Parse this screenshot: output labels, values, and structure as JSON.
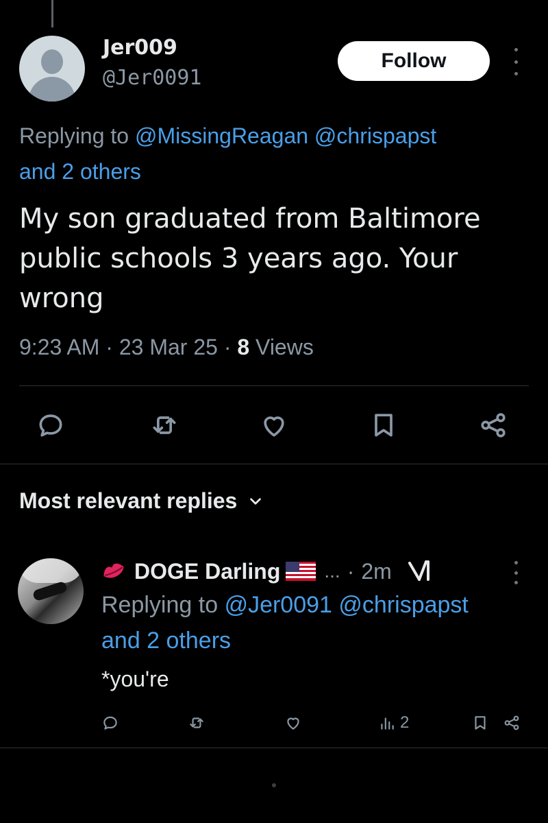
{
  "colors": {
    "background": "#000000",
    "link": "#4a9fe8",
    "muted": "#8b98a5",
    "text": "#e7e9ea"
  },
  "tweet": {
    "display_name": "Jer009",
    "handle": "@Jer0091",
    "follow_label": "Follow",
    "replying_prefix": "Replying to",
    "replying_mentions": "@MissingReagan @chrispapst",
    "replying_others": "and 2 others",
    "text": "My son graduated from Baltimore public schools 3 years ago. Your wrong",
    "time": "9:23 AM",
    "date": "23 Mar 25",
    "views_count": "8",
    "views_label": "Views",
    "actions": [
      "reply-icon",
      "retweet-icon",
      "like-icon",
      "bookmark-icon",
      "share-icon"
    ]
  },
  "replies_section": {
    "sort_label": "Most relevant replies"
  },
  "reply": {
    "display_name": "DOGE Darling",
    "ellipsis": "...",
    "time": "2m",
    "replying_prefix": "Replying to",
    "replying_mentions": "@Jer0091 @chrispapst",
    "replying_others": "and 2 others",
    "text": "*you're",
    "views": "2",
    "icons": [
      "kiss-lips-icon",
      "us-flag-icon",
      "grok-icon"
    ]
  }
}
